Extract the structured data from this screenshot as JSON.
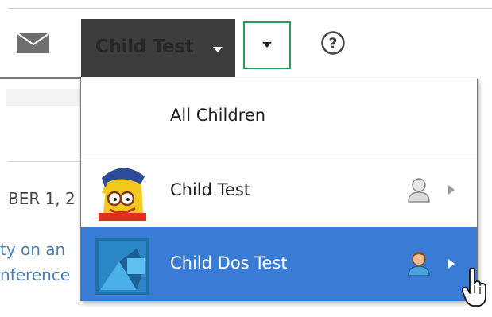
{
  "header": {
    "child_switcher_label": "Child Test"
  },
  "background": {
    "date_fragment": "BER 1, 2",
    "link_line_1": "ty on an",
    "link_line_2": "nference"
  },
  "child_menu": {
    "items": [
      {
        "label": "All Children",
        "selected": false
      },
      {
        "label": "Child Test",
        "selected": false
      },
      {
        "label": "Child Dos Test",
        "selected": true
      }
    ]
  },
  "colors": {
    "switcher_bg": "#3d3d3d",
    "switcher_text": "#262626",
    "options_border": "#2e9a5a",
    "menu_highlight": "#3a7bd5",
    "link": "#4a7bb5"
  },
  "icons": {
    "mail": "envelope-icon",
    "help": "question-circle-icon",
    "person": "person-icon",
    "chevron": "chevron-right-icon",
    "cursor": "hand-pointer-icon"
  }
}
